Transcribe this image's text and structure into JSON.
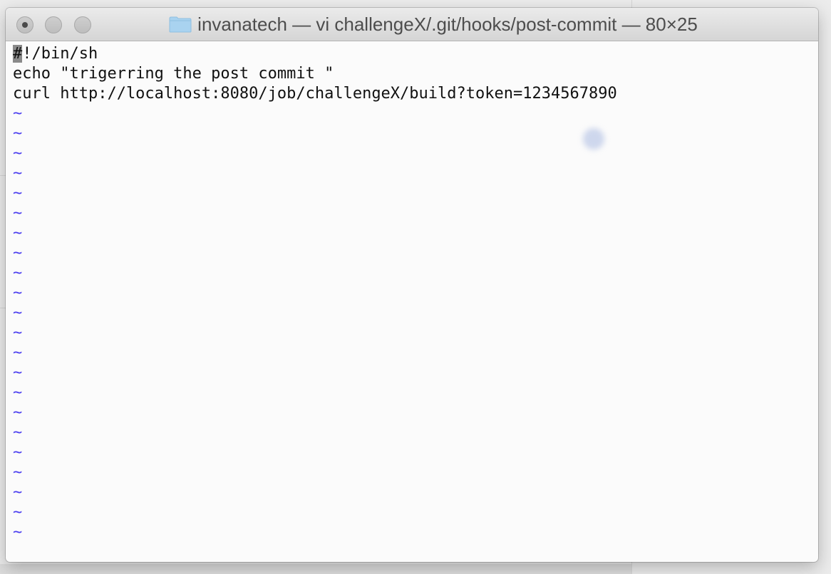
{
  "window": {
    "title": "invanatech — vi challengeX/.git/hooks/post-commit — 80×25",
    "folder_icon": "folder-icon",
    "folder_color": "#a9d3f0"
  },
  "editor": {
    "cursor_char": "#",
    "line1_rest": "!/bin/sh",
    "line2": "echo \"trigerring the post commit \"",
    "line3": "curl http://localhost:8080/job/challengeX/build?token=1234567890",
    "empty_marker": "~",
    "empty_lines": [
      "~",
      "~",
      "~",
      "~",
      "~",
      "~",
      "~",
      "~",
      "~",
      "~",
      "~",
      "~",
      "~",
      "~",
      "~",
      "~",
      "~",
      "~",
      "~",
      "~",
      "~",
      "~"
    ],
    "tilde_color": "#4a3df0"
  }
}
